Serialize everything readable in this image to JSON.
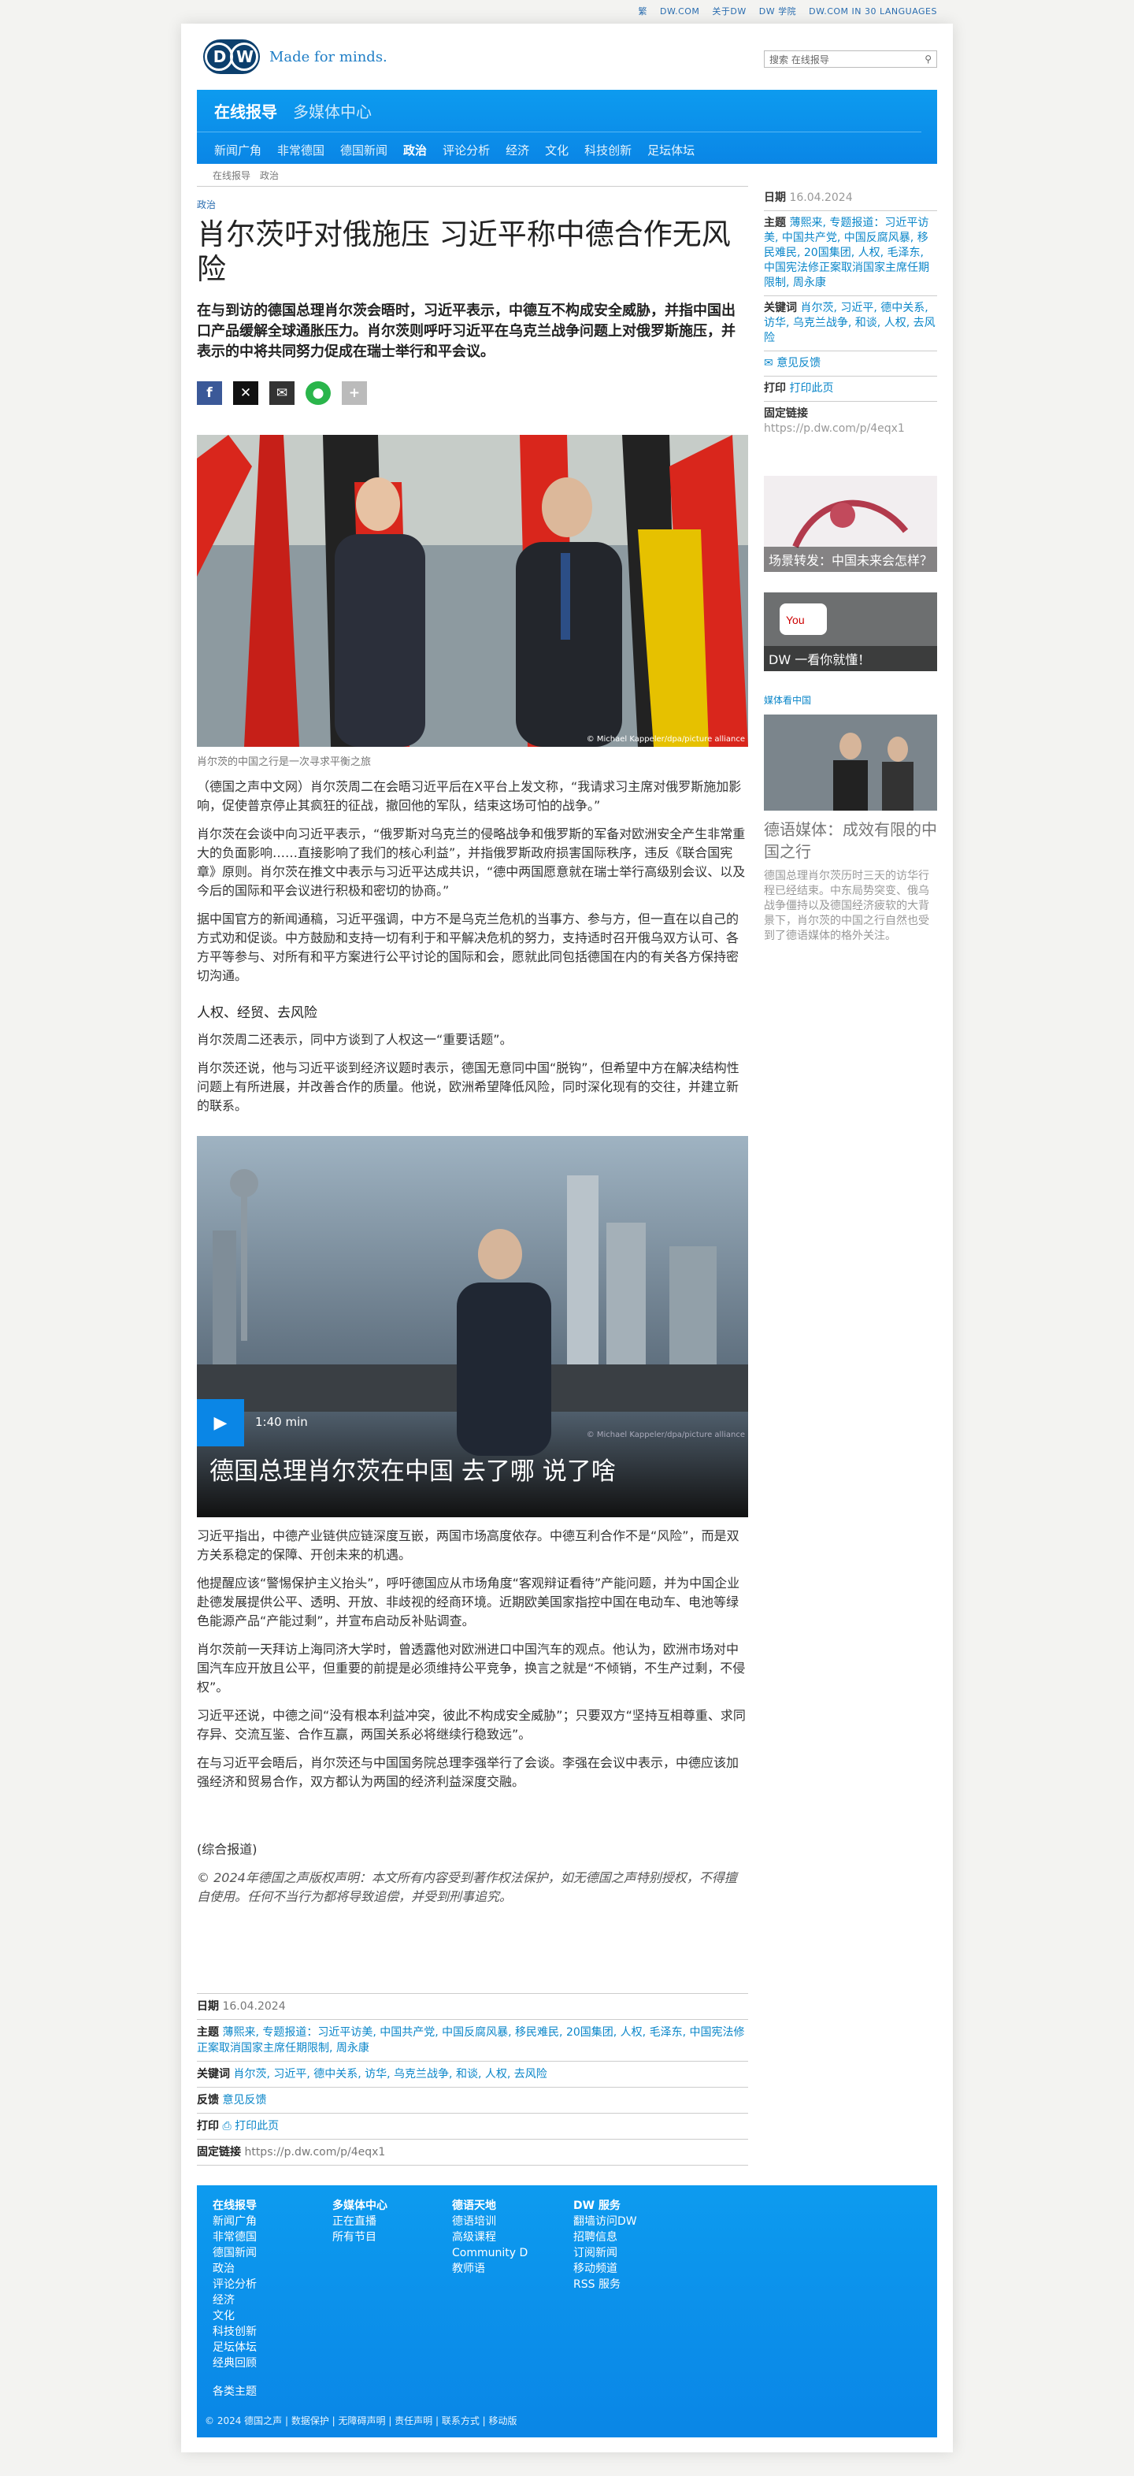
{
  "topbar": [
    "繁",
    "DW.COM",
    "关于DW",
    "DW 学院",
    "DW.COM IN 30 LANGUAGES"
  ],
  "logo": {
    "mark": "DW",
    "tagline": "Made for minds."
  },
  "search": {
    "placeholder": "搜索 在线报导"
  },
  "nav": {
    "primary": "在线报导",
    "secondary": "多媒体中心",
    "items": [
      "新闻广角",
      "非常德国",
      "德国新闻",
      "政治",
      "评论分析",
      "经济",
      "文化",
      "科技创新",
      "足坛体坛"
    ],
    "active": "政治"
  },
  "breadcrumb": [
    "在线报导",
    "政治"
  ],
  "article": {
    "kicker": "政治",
    "title": "肖尔茨吁对俄施压 习近平称中德合作无风险",
    "lead": "在与到访的德国总理肖尔茨会晤时，习近平表示，中德互不构成安全威胁，并指中国出口产品缓解全球通胀压力。肖尔茨则呼吁习近平在乌克兰战争问题上对俄罗斯施压，并表示的中将共同努力促成在瑞士举行和平会议。",
    "hero_credit": "© Michael Kappeler/dpa/picture alliance",
    "caption": "肖尔茨的中国之行是一次寻求平衡之旅",
    "p1": "（德国之声中文网）肖尔茨周二在会晤习近平后在X平台上发文称，“我请求习主席对俄罗斯施加影响，促使普京停止其疯狂的征战，撤回他的军队，结束这场可怕的战争。”",
    "p2": "肖尔茨在会谈中向习近平表示，“俄罗斯对乌克兰的侵略战争和俄罗斯的军备对欧洲安全产生非常重大的负面影响……直接影响了我们的核心利益”，并指俄罗斯政府损害国际秩序，违反《联合国宪章》原则。肖尔茨在推文中表示与习近平达成共识，“德中两国愿意就在瑞士举行高级别会议、以及今后的国际和平会议进行积极和密切的协商。”",
    "p3": "据中国官方的新闻通稿，习近平强调，中方不是乌克兰危机的当事方、参与方，但一直在以自己的方式劝和促谈。中方鼓励和支持一切有利于和平解决危机的努力，支持适时召开俄乌双方认可、各方平等参与、对所有和平方案进行公平讨论的国际和会，愿就此同包括德国在内的有关各方保持密切沟通。",
    "h2": "人权、经贸、去风险",
    "p4": "肖尔茨周二还表示，同中方谈到了人权这一“重要话题”。",
    "p5": "肖尔茨还说，他与习近平谈到经济议题时表示，德国无意同中国“脱钩”，但希望中方在解决结构性问题上有所进展，并改善合作的质量。他说，欧洲希望降低风险，同时深化现有的交往，并建立新的联系。",
    "video": {
      "duration": "1:40 min",
      "title": "德国总理肖尔茨在中国 去了哪 说了啥",
      "credit": "© Michael Kappeler/dpa/picture alliance"
    },
    "p6": "习近平指出，中德产业链供应链深度互嵌，两国市场高度依存。中德互利合作不是“风险”，而是双方关系稳定的保障、开创未来的机遇。",
    "p7": "他提醒应该“警惕保护主义抬头”，呼吁德国应从市场角度“客观辩证看待”产能问题，并为中国企业赴德发展提供公平、透明、开放、非歧视的经商环境。近期欧美国家指控中国在电动车、电池等绿色能源产品“产能过剩”，并宣布启动反补贴调查。",
    "p8": "肖尔茨前一天拜访上海同济大学时，曾透露他对欧洲进口中国汽车的观点。他认为，欧洲市场对中国汽车应开放且公平，但重要的前提是必须维持公平竞争，换言之就是“不倾销，不生产过剩，不侵权”。",
    "p9": "习近平还说，中德之间“没有根本利益冲突，彼此不构成安全威胁”；只要双方“坚持互相尊重、求同存异、交流互鉴、合作互赢，两国关系必将继续行稳致远”。",
    "p10": "在与习近平会晤后，肖尔茨还与中国国务院总理李强举行了会谈。李强在会议中表示，中德应该加强经济和贸易合作，双方都认为两国的经济利益深度交融。",
    "source": "(综合报道)",
    "rights": "© 2024年德国之声版权声明：本文所有内容受到著作权法保护，如无德国之声特别授权，不得擅自使用。任何不当行为都将导致追偿，并受到刑事追究。"
  },
  "meta": {
    "date_label": "日期",
    "date": "16.04.2024",
    "topics_label": "主题",
    "topics": "薄熙来, 专题报道：习近平访美, 中国共产党, 中国反腐风暴, 移民难民, 20国集团, 人权, 毛泽东, 中国宪法修正案取消国家主席任期限制, 周永康",
    "keywords_label": "关键词",
    "keywords": "肖尔茨, 习近平, 德中关系, 访华, 乌克兰战争, 和谈, 人权, 去风险",
    "feedback_label": "反馈",
    "feedback": "意见反馈",
    "print_label": "打印",
    "print": "打印此页",
    "permalink_label": "固定链接",
    "permalink": "https://p.dw.com/p/4eqx1"
  },
  "side": {
    "thumb1": "场景转发：中国未来会怎样？",
    "thumb2": "DW 一看你就懂！",
    "media_label": "媒体看中国",
    "media_title": "德语媒体：成效有限的中国之行",
    "media_text": "德国总理肖尔茨历时三天的访华行程已经结束。中东局势突变、俄乌战争僵持以及德国经济疲软的大背景下，肖尔茨的中国之行自然也受到了德语媒体的格外关注。"
  },
  "footer": {
    "col1": {
      "head": "在线报导",
      "items": [
        "新闻广角",
        "非常德国",
        "德国新闻",
        "政治",
        "评论分析",
        "经济",
        "文化",
        "科技创新",
        "足坛体坛",
        "经典回顾"
      ]
    },
    "col2": {
      "head": "多媒体中心",
      "items": [
        "正在直播",
        "所有节目"
      ]
    },
    "col3": {
      "head": "德语天地",
      "items": [
        "德语培训",
        "高级课程",
        "Community D",
        "教师语"
      ]
    },
    "col4": {
      "head": "DW 服务",
      "items": [
        "翻墙访问DW",
        "招聘信息",
        "订阅新闻",
        "移动频道",
        "RSS 服务"
      ]
    },
    "more": "各类主题",
    "copyright": "© 2024 德国之声 | 数据保护 | 无障碍声明 | 责任声明 | 联系方式 | 移动版"
  },
  "colors": {
    "accent": "#0a86e6",
    "link": "#0a86c9",
    "brand": "#0c3f6d"
  }
}
